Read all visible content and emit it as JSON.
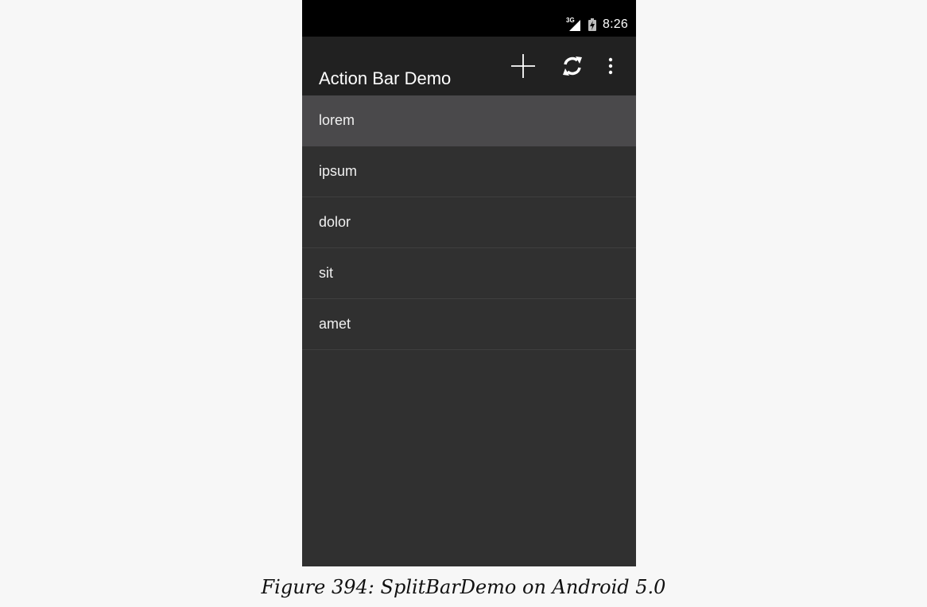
{
  "status_bar": {
    "network_type": "3G",
    "time": "8:26",
    "icons": [
      "signal-icon",
      "battery-charging-icon"
    ]
  },
  "action_bar": {
    "title": "Action Bar Demo",
    "actions": [
      "add-icon",
      "refresh-icon",
      "overflow-menu-icon"
    ]
  },
  "list": {
    "items": [
      {
        "label": "lorem",
        "selected": true
      },
      {
        "label": "ipsum",
        "selected": false
      },
      {
        "label": "dolor",
        "selected": false
      },
      {
        "label": "sit",
        "selected": false
      },
      {
        "label": "amet",
        "selected": false
      }
    ]
  },
  "caption": "Figure 394: SplitBarDemo on Android 5.0",
  "colors": {
    "status_bar_bg": "#000000",
    "action_bar_bg": "#212121",
    "content_bg": "#303030",
    "selected_item_bg": "#4a494b",
    "page_bg": "#f7f7f7"
  }
}
